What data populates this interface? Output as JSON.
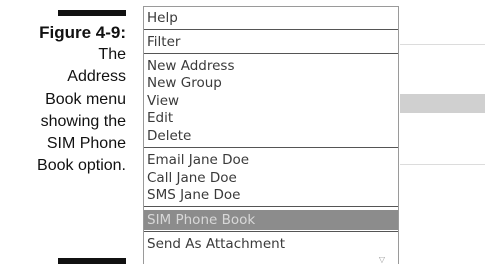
{
  "caption": {
    "label": "Figure 4-9:",
    "lines": [
      "The",
      "Address",
      "Book menu",
      "showing the",
      "SIM Phone",
      "Book option."
    ]
  },
  "menu": {
    "items": [
      {
        "label": "Help",
        "selected": false
      },
      {
        "label": "Filter",
        "selected": false
      },
      {
        "label": "New Address",
        "selected": false
      },
      {
        "label": "New Group",
        "selected": false
      },
      {
        "label": "View",
        "selected": false
      },
      {
        "label": "Edit",
        "selected": false
      },
      {
        "label": "Delete",
        "selected": false
      },
      {
        "label": "Email Jane Doe",
        "selected": false
      },
      {
        "label": "Call Jane Doe",
        "selected": false
      },
      {
        "label": "SMS Jane Doe",
        "selected": false
      },
      {
        "label": "SIM Phone Book",
        "selected": true
      },
      {
        "label": "Send As Attachment",
        "selected": false
      }
    ],
    "scroll_icon": "chevron-down-icon"
  },
  "colors": {
    "selected_bg": "#8c8c8c",
    "selected_text": "#d8d8d8",
    "item_text": "#3a3a3a",
    "separator": "#555555"
  }
}
